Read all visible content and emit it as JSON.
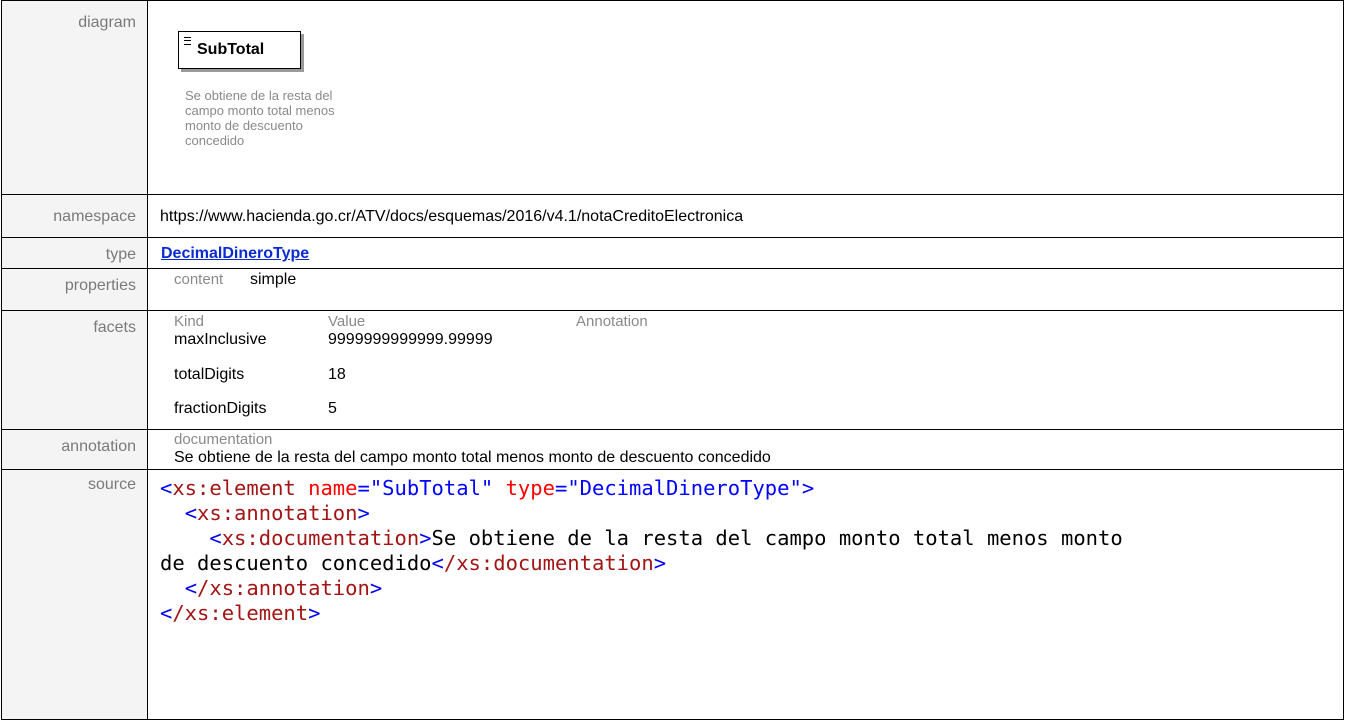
{
  "labels": {
    "diagram": "diagram",
    "namespace": "namespace",
    "type": "type",
    "properties": "properties",
    "facets": "facets",
    "annotation": "annotation",
    "source": "source"
  },
  "diagram": {
    "element_name": "SubTotal",
    "doc_lines": [
      "Se obtiene de la resta del",
      "campo monto total menos",
      "monto de descuento",
      "concedido"
    ],
    "icon": "element-lines-icon"
  },
  "namespace": "https://www.hacienda.go.cr/ATV/docs/esquemas/2016/v4.1/notaCreditoElectronica",
  "type": "DecimalDineroType",
  "properties": {
    "key": "content",
    "value": "simple"
  },
  "facets": {
    "headers": [
      "Kind",
      "Value",
      "Annotation"
    ],
    "rows": [
      {
        "kind": "maxInclusive",
        "value": "9999999999999.99999"
      },
      {
        "kind": "totalDigits",
        "value": "18"
      },
      {
        "kind": "fractionDigits",
        "value": "5"
      }
    ]
  },
  "annotation": {
    "key": "documentation",
    "text": "Se obtiene de la resta del campo monto total menos monto de descuento concedido"
  },
  "source": {
    "element_tag": "xs:element",
    "attr_name": "name",
    "name_value": "\"SubTotal\"",
    "attr_type": "type",
    "type_value": "\"DecimalDineroType\"",
    "annotation_tag": "xs:annotation",
    "documentation_tag": "xs:documentation",
    "doc_text_1": "Se obtiene de la resta del campo monto total menos monto",
    "doc_text_2": "de descuento concedido",
    "close_documentation": "/xs:documentation",
    "close_annotation": "/xs:annotation",
    "close_element": "/xs:element"
  },
  "colors": {
    "tag": "#a31515",
    "punct": "#0000ff",
    "attr": "#ff0000",
    "link": "#0a2bd4"
  }
}
